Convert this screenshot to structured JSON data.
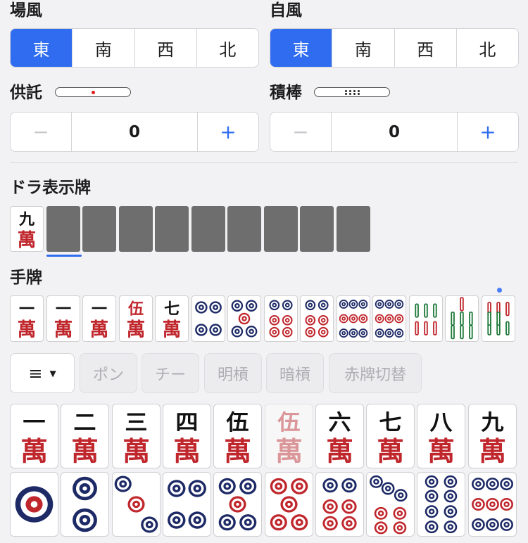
{
  "bakaze": {
    "label": "場風",
    "options": [
      "東",
      "南",
      "西",
      "北"
    ],
    "selected": 0
  },
  "jikaze": {
    "label": "自風",
    "options": [
      "東",
      "南",
      "西",
      "北"
    ],
    "selected": 0
  },
  "kyotaku": {
    "label": "供託",
    "value": "0",
    "minus": "−",
    "plus": "+"
  },
  "tsumibo": {
    "label": "積棒",
    "value": "0",
    "minus": "−",
    "plus": "+"
  },
  "dora": {
    "label": "ドラ表示牌",
    "tiles": [
      {
        "kind": "m",
        "rank": 9
      }
    ],
    "empty_slots": 9
  },
  "hand": {
    "label": "手牌",
    "tiles": [
      {
        "kind": "m",
        "rank": 1
      },
      {
        "kind": "m",
        "rank": 1
      },
      {
        "kind": "m",
        "rank": 1
      },
      {
        "kind": "m",
        "rank": 5,
        "red": true
      },
      {
        "kind": "m",
        "rank": 7
      },
      {
        "kind": "p",
        "rank": 4
      },
      {
        "kind": "p",
        "rank": 5
      },
      {
        "kind": "p",
        "rank": 6
      },
      {
        "kind": "p",
        "rank": 6
      },
      {
        "kind": "p",
        "rank": 9
      },
      {
        "kind": "p",
        "rank": 9
      },
      {
        "kind": "s",
        "rank": 6
      },
      {
        "kind": "s",
        "rank": 7
      },
      {
        "kind": "s",
        "rank": 8
      }
    ]
  },
  "actions": {
    "menu": "≡",
    "pon": "ポン",
    "chi": "チー",
    "minkan": "明槓",
    "ankan": "暗槓",
    "aka": "赤牌切替"
  },
  "manzu_kanji": [
    "一",
    "二",
    "三",
    "四",
    "伍",
    "六",
    "七",
    "八",
    "九"
  ],
  "wan_char": "萬",
  "picker_row1": [
    {
      "kind": "m",
      "rank": 1
    },
    {
      "kind": "m",
      "rank": 2
    },
    {
      "kind": "m",
      "rank": 3
    },
    {
      "kind": "m",
      "rank": 4
    },
    {
      "kind": "m",
      "rank": 5
    },
    {
      "kind": "m",
      "rank": 5,
      "red": true,
      "faded": true
    },
    {
      "kind": "m",
      "rank": 6
    },
    {
      "kind": "m",
      "rank": 7
    },
    {
      "kind": "m",
      "rank": 8
    },
    {
      "kind": "m",
      "rank": 9
    }
  ],
  "picker_row2": [
    {
      "kind": "p",
      "rank": 1
    },
    {
      "kind": "p",
      "rank": 2
    },
    {
      "kind": "p",
      "rank": 3
    },
    {
      "kind": "p",
      "rank": 4
    },
    {
      "kind": "p",
      "rank": 5
    },
    {
      "kind": "p",
      "rank": 5,
      "red": true
    },
    {
      "kind": "p",
      "rank": 6
    },
    {
      "kind": "p",
      "rank": 7
    },
    {
      "kind": "p",
      "rank": 8
    },
    {
      "kind": "p",
      "rank": 9
    }
  ],
  "colors": {
    "accent": "#2f6cf0",
    "tile_red": "#c0272d",
    "tile_navy": "#1d2a66",
    "tile_green": "#1f7a3a"
  }
}
